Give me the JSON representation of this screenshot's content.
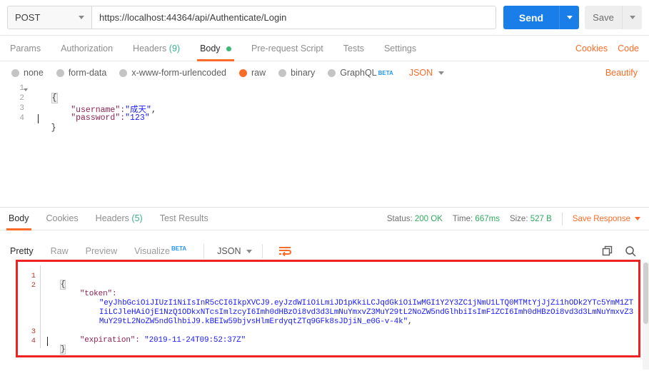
{
  "request": {
    "method": "POST",
    "url": "https://localhost:44364/api/Authenticate/Login",
    "send_label": "Send",
    "save_label": "Save",
    "tabs": [
      {
        "label": "Params",
        "active": false
      },
      {
        "label": "Authorization",
        "active": false
      },
      {
        "label": "Headers",
        "count": "(9)",
        "active": false
      },
      {
        "label": "Body",
        "active": true,
        "dot": true
      },
      {
        "label": "Pre-request Script",
        "active": false
      },
      {
        "label": "Tests",
        "active": false
      },
      {
        "label": "Settings",
        "active": false
      }
    ],
    "tabs_right": [
      "Cookies",
      "Code"
    ],
    "body_types": [
      {
        "label": "none",
        "selected": false
      },
      {
        "label": "form-data",
        "selected": false
      },
      {
        "label": "x-www-form-urlencoded",
        "selected": false
      },
      {
        "label": "raw",
        "selected": true
      },
      {
        "label": "binary",
        "selected": false
      },
      {
        "label": "GraphQL",
        "selected": false,
        "beta": "BETA"
      }
    ],
    "format_select": "JSON",
    "beautify_label": "Beautify",
    "editor": {
      "line_numbers": [
        "1",
        "2",
        "3",
        "4"
      ],
      "lines": [
        {
          "segments": [
            {
              "t": "{",
              "c": "j-punc"
            }
          ]
        },
        {
          "segments": [
            {
              "t": "    \"username\":",
              "c": "j-key"
            },
            {
              "t": "\"成天\"",
              "c": "j-str"
            },
            {
              "t": ",",
              "c": "j-punc"
            }
          ]
        },
        {
          "segments": [
            {
              "t": "    \"password\":",
              "c": "j-key"
            },
            {
              "t": "\"123\"",
              "c": "j-str"
            }
          ]
        },
        {
          "segments": [
            {
              "t": "}",
              "c": "j-punc"
            }
          ]
        }
      ]
    }
  },
  "response": {
    "tabs": [
      {
        "label": "Body",
        "active": true
      },
      {
        "label": "Cookies",
        "active": false
      },
      {
        "label": "Headers",
        "count": "(5)",
        "active": false
      },
      {
        "label": "Test Results",
        "active": false
      }
    ],
    "status_label": "Status:",
    "status_value": "200 OK",
    "time_label": "Time:",
    "time_value": "667ms",
    "size_label": "Size:",
    "size_value": "527 B",
    "save_response_label": "Save Response",
    "view_tabs": [
      {
        "label": "Pretty",
        "active": true
      },
      {
        "label": "Raw",
        "active": false
      },
      {
        "label": "Preview",
        "active": false
      },
      {
        "label": "Visualize",
        "active": false,
        "beta": "BETA"
      }
    ],
    "format_select": "JSON",
    "wrap_icon": "word-wrap-icon",
    "copy_icon": "copy-icon",
    "search_icon": "search-icon",
    "editor": {
      "line_numbers": [
        "1",
        "2",
        "3",
        "4"
      ],
      "lines": [
        {
          "indent": 0,
          "segments": [
            {
              "t": "{",
              "c": "rp"
            }
          ]
        },
        {
          "indent": 1,
          "segments": [
            {
              "t": "\"token\":",
              "c": "rk"
            }
          ]
        },
        {
          "indent": 2,
          "segments": [
            {
              "t": "\"eyJhbGciOiJIUzI1NiIsInR5cCI6IkpXVCJ9.eyJzdWIiOiLmiJD1pKkiLCJqdGkiOiIwMGI1Y2Y3ZC1jNmU1LTQ0MTMtYjJjZi1hODk2YTc5YmM1ZT",
              "c": "rv"
            }
          ]
        },
        {
          "indent": 2,
          "segments": [
            {
              "t": "IiLCJleHAiOjE1NzQ1ODkxNTcsImlzcyI6Imh0dHBzOi8vd3d3LmNuYmxvZ3MuY29tL2NoZW5ndGlhbiIsImF1ZCI6Imh0dHBzOi8vd3d3LmNuYmxvZ3",
              "c": "rv"
            }
          ]
        },
        {
          "indent": 2,
          "segments": [
            {
              "t": "MuY29tL2NoZW5ndGlhbiJ9.kBEIw59bjvsHlmErdyqtZTq9GFk8sJDjiN_e0G-v-4k\"",
              "c": "rv"
            },
            {
              "t": ",",
              "c": "rp"
            }
          ]
        },
        {
          "indent": 1,
          "segments": [
            {
              "t": "\"expiration\": ",
              "c": "rk"
            },
            {
              "t": "\"2019-11-24T09:52:37Z\"",
              "c": "rv"
            }
          ]
        },
        {
          "indent": 0,
          "segments": [
            {
              "t": "}",
              "c": "rp"
            }
          ]
        }
      ]
    }
  },
  "colors": {
    "accent_orange": "#fa6c28",
    "send_blue": "#1a7ee8",
    "status_green": "#2eab5f",
    "annotation_red": "#ee2222",
    "json_key": "#8b2252",
    "json_value": "#1a1aff"
  }
}
